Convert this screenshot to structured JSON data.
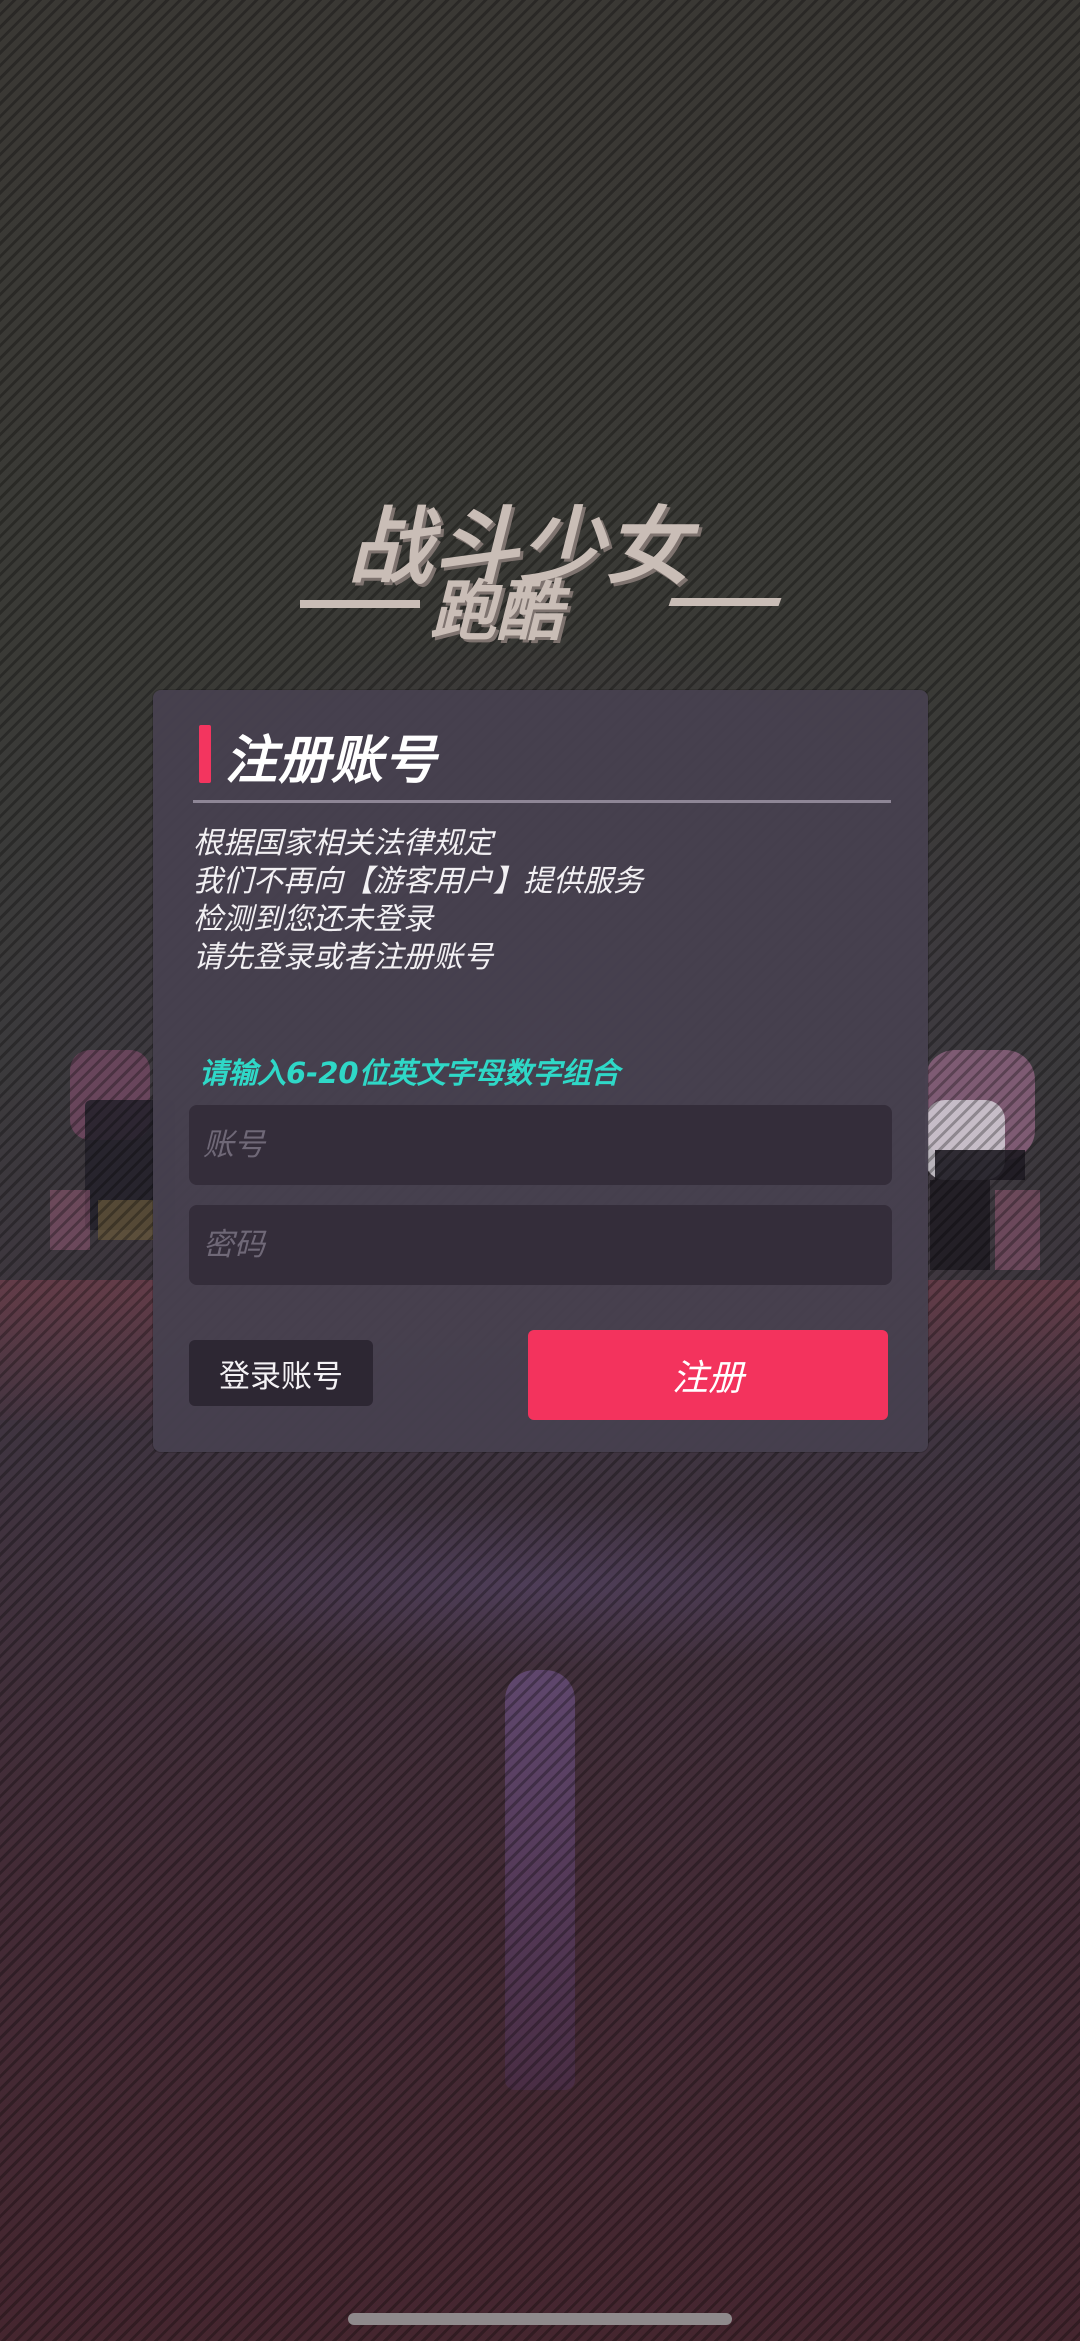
{
  "logo": {
    "line1": "战斗少女",
    "line2": "跑酷"
  },
  "dialog": {
    "title": "注册账号",
    "notice_lines": [
      "根据国家相关法律规定",
      "我们不再向【游客用户】提供服务",
      "检测到您还未登录",
      "请先登录或者注册账号"
    ],
    "hint": "请输入6-20位英文字母数字组合",
    "account_placeholder": "账号",
    "password_placeholder": "密码",
    "login_label": "登录账号",
    "register_label": "注册"
  },
  "colors": {
    "accent": "#f3335d",
    "hint": "#2fd8c7",
    "dialog_bg": "#46404e",
    "input_bg": "#342d3a"
  }
}
